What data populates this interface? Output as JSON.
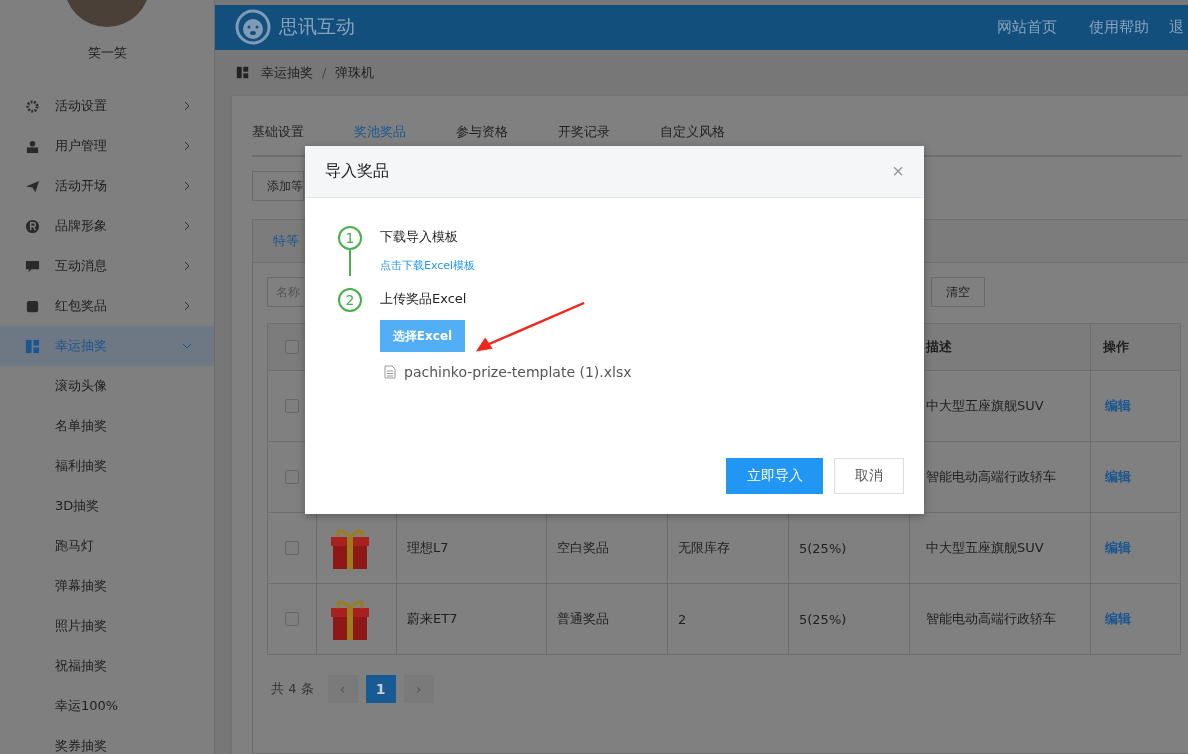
{
  "sidebar": {
    "user": {
      "name": "笑一笑"
    },
    "items": [
      {
        "label": "活动设置",
        "selected": false,
        "expanded": false
      },
      {
        "label": "用户管理",
        "selected": false,
        "expanded": false
      },
      {
        "label": "活动开场",
        "selected": false,
        "expanded": false
      },
      {
        "label": "品牌形象",
        "selected": false,
        "expanded": false
      },
      {
        "label": "互动消息",
        "selected": false,
        "expanded": false
      },
      {
        "label": "红包奖品",
        "selected": false,
        "expanded": false
      },
      {
        "label": "幸运抽奖",
        "selected": true,
        "expanded": true,
        "children": [
          {
            "label": "滚动头像",
            "selected": false
          },
          {
            "label": "名单抽奖",
            "selected": false
          },
          {
            "label": "福利抽奖",
            "selected": false
          },
          {
            "label": "3D抽奖",
            "selected": false
          },
          {
            "label": "跑马灯",
            "selected": false
          },
          {
            "label": "弹幕抽奖",
            "selected": false
          },
          {
            "label": "照片抽奖",
            "selected": false
          },
          {
            "label": "祝福抽奖",
            "selected": false
          },
          {
            "label": "幸运100%",
            "selected": false
          },
          {
            "label": "奖券抽奖",
            "selected": false
          }
        ]
      }
    ]
  },
  "header": {
    "title": "思讯互动",
    "nav": [
      "网站首页",
      "使用帮助",
      "退"
    ]
  },
  "breadcrumb": {
    "items": [
      "幸运抽奖",
      "弹珠机"
    ],
    "separator": "/"
  },
  "tabs": [
    {
      "label": "基础设置",
      "selected": false
    },
    {
      "label": "奖池奖品",
      "selected": true
    },
    {
      "label": "参与资格",
      "selected": false
    },
    {
      "label": "开奖记录",
      "selected": false
    },
    {
      "label": "自定义风格",
      "selected": false
    }
  ],
  "toolbar": {
    "add_button": "添加等"
  },
  "prize_tabs": [
    {
      "label": "特等",
      "selected": true
    }
  ],
  "filter": {
    "placeholder": "名称",
    "clear_button": "清空"
  },
  "table": {
    "header_checked": false,
    "columns": [
      "描述",
      "操作"
    ],
    "rows": [
      {
        "checked": false,
        "description": "中大型五座旗舰SUV",
        "action": "编辑"
      },
      {
        "checked": false,
        "description": "智能电动高端行政轿车",
        "action": "编辑"
      },
      {
        "checked": false,
        "name": "理想L7",
        "type": "空白奖品",
        "stock": "无限库存",
        "probability": "5(25%)",
        "description": "中大型五座旗舰SUV",
        "action": "编辑"
      },
      {
        "checked": false,
        "name": "蔚来ET7",
        "type": "普通奖品",
        "stock": "2",
        "probability": "5(25%)",
        "description": "智能电动高端行政轿车",
        "action": "编辑"
      }
    ]
  },
  "pagination": {
    "total": "共 4 条",
    "prev": "‹",
    "pages": [
      {
        "label": "1",
        "selected": true
      }
    ],
    "next": "›"
  },
  "dialog": {
    "title": "导入奖品",
    "close": "×",
    "steps": [
      {
        "number": "1",
        "title": "下载导入模板",
        "link": "点击下载Excel模板"
      },
      {
        "number": "2",
        "title": "上传奖品Excel",
        "button": "选择Excel",
        "file": "pachinko-prize-template (1).xlsx"
      }
    ],
    "confirm": "立即导入",
    "cancel": "取消"
  }
}
